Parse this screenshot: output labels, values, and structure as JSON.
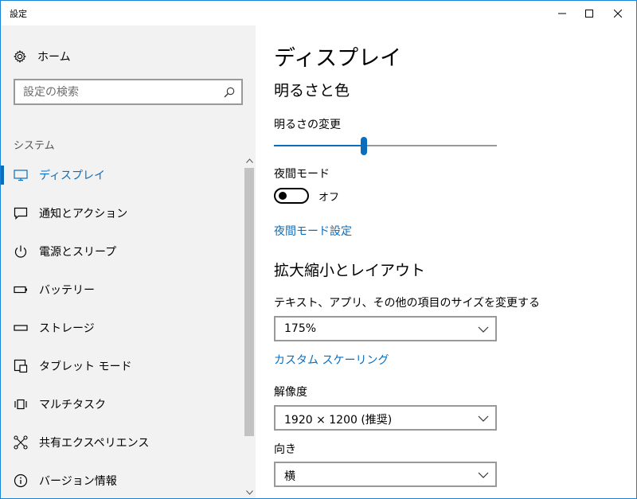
{
  "window": {
    "title": "設定"
  },
  "sidebar": {
    "home_label": "ホーム",
    "search_placeholder": "設定の検索",
    "section_label": "システム",
    "items": [
      {
        "label": "ディスプレイ",
        "icon": "monitor-icon",
        "active": true
      },
      {
        "label": "通知とアクション",
        "icon": "message-icon",
        "active": false
      },
      {
        "label": "電源とスリープ",
        "icon": "power-icon",
        "active": false
      },
      {
        "label": "バッテリー",
        "icon": "battery-icon",
        "active": false
      },
      {
        "label": "ストレージ",
        "icon": "storage-icon",
        "active": false
      },
      {
        "label": "タブレット モード",
        "icon": "tablet-icon",
        "active": false
      },
      {
        "label": "マルチタスク",
        "icon": "multitask-icon",
        "active": false
      },
      {
        "label": "共有エクスペリエンス",
        "icon": "share-icon",
        "active": false
      },
      {
        "label": "バージョン情報",
        "icon": "info-icon",
        "active": false
      }
    ]
  },
  "content": {
    "page_title": "ディスプレイ",
    "brightness_section": {
      "heading": "明るさと色",
      "brightness_label": "明るさの変更",
      "brightness_level": 0.4,
      "night_mode_label": "夜間モード",
      "night_mode_state": "オフ",
      "night_mode_settings_link": "夜間モード設定"
    },
    "scale_section": {
      "heading": "拡大縮小とレイアウト",
      "scale_label": "テキスト、アプリ、その他の項目のサイズを変更する",
      "scale_value": "175%",
      "custom_scaling_link": "カスタム スケーリング",
      "resolution_label": "解像度",
      "resolution_value": "1920 × 1200 (推奨)",
      "orientation_label": "向き",
      "orientation_value": "横"
    }
  },
  "colors": {
    "accent": "#0a6ebd",
    "window_border": "#1883d7",
    "sidebar_bg": "#f2f2f2"
  }
}
